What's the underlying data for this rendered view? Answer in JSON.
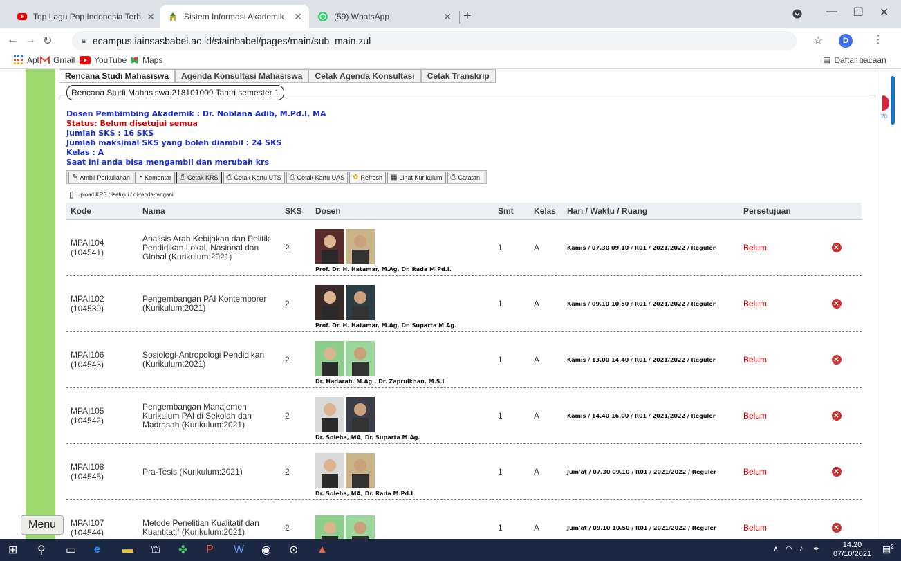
{
  "browser": {
    "tabs": [
      {
        "title": "Top Lagu Pop Indonesia Terbaru",
        "icon": "youtube-icon"
      },
      {
        "title": "Sistem Informasi Akademik",
        "icon": "mosque-icon",
        "active": true
      },
      {
        "title": "(59) WhatsApp",
        "icon": "whatsapp-icon"
      }
    ],
    "url": "ecampus.iainsasbabel.ac.id/stainbabel/pages/main/sub_main.zul",
    "profile_initial": "D",
    "bookmarks": [
      {
        "label": "Apl",
        "icon": "apps-grid-icon"
      },
      {
        "label": "Gmail",
        "icon": "gmail-icon"
      },
      {
        "label": "YouTube",
        "icon": "youtube-icon"
      },
      {
        "label": "Maps",
        "icon": "maps-icon"
      }
    ],
    "reading_list": "Daftar bacaan"
  },
  "subtabs": [
    "Rencana Studi Mahasiswa",
    "Agenda Konsultasi Mahasiswa",
    "Cetak Agenda Konsultasi",
    "Cetak Transkrip"
  ],
  "panel_title": "Rencana Studi Mahasiswa 218101009 Tantri semester 1",
  "info": {
    "dosen": "Dosen Pembimbing Akademik : Dr. Noblana Adib, M.Pd.I, MA",
    "status": "Status: Belum disetujui semua",
    "jumlah_sks": "Jumlah SKS : 16 SKS",
    "max_sks": "Jumlah maksimal SKS yang boleh diambil : 24 SKS",
    "kelas": "Kelas : A",
    "note": "Saat ini anda bisa mengambil dan merubah krs"
  },
  "toolbar_buttons": [
    {
      "label": "Ambil Perkuliahan",
      "icon": "pen-icon"
    },
    {
      "label": "Komentar",
      "icon": "comment-icon"
    },
    {
      "label": "Cetak KRS",
      "icon": "printer-icon"
    },
    {
      "label": "Cetak Kartu UTS",
      "icon": "printer-icon"
    },
    {
      "label": "Cetak Kartu UAS",
      "icon": "printer-icon"
    },
    {
      "label": "Refresh",
      "icon": "refresh-icon"
    },
    {
      "label": "Lihat Kurikulum",
      "icon": "table-icon"
    },
    {
      "label": "Catatan",
      "icon": "printer-icon"
    }
  ],
  "upload_label": "Upload KRS disetujui / di-tanda-tangani",
  "table": {
    "headers": [
      "Kode",
      "Nama",
      "SKS",
      "Dosen",
      "Smt",
      "Kelas",
      "Hari / Waktu / Ruang",
      "Persetujuan",
      ""
    ],
    "rows": [
      {
        "kode": "MPAI104 (104541)",
        "nama": "Analisis Arah Kebijakan dan Politik Pendidikan Lokal, Nasional dan Global (Kurikulum:2021)",
        "sks": "2",
        "dosen": "Prof. Dr. H. Hatamar, M.Ag, Dr. Rada M.Pd.I.",
        "smt": "1",
        "kelas": "A",
        "hari": "Kamis / 07.30 09.10 / R01 / 2021/2022 / Reguler",
        "persetujuan": "Belum"
      },
      {
        "kode": "MPAI102 (104539)",
        "nama": "Pengembangan PAI Kontemporer (Kurikulum:2021)",
        "sks": "2",
        "dosen": "Prof. Dr. H. Hatamar, M.Ag, Dr. Suparta M.Ag.",
        "smt": "1",
        "kelas": "A",
        "hari": "Kamis / 09.10 10.50 / R01 / 2021/2022 / Reguler",
        "persetujuan": "Belum"
      },
      {
        "kode": "MPAI106 (104543)",
        "nama": "Sosiologi-Antropologi Pendidikan (Kurikulum:2021)",
        "sks": "2",
        "dosen": "Dr. Hadarah, M.Ag., Dr. Zaprulkhan, M.S.I",
        "smt": "1",
        "kelas": "A",
        "hari": "Kamis / 13.00 14.40 / R01 / 2021/2022 / Reguler",
        "persetujuan": "Belum"
      },
      {
        "kode": "MPAI105 (104542)",
        "nama": "Pengembangan Manajemen Kurikulum PAI di Sekolah dan Madrasah (Kurikulum:2021)",
        "sks": "2",
        "dosen": "Dr. Soleha, MA, Dr. Suparta M.Ag.",
        "smt": "1",
        "kelas": "A",
        "hari": "Kamis / 14.40 16.00 / R01 / 2021/2022 / Reguler",
        "persetujuan": "Belum"
      },
      {
        "kode": "MPAI108 (104545)",
        "nama": "Pra-Tesis (Kurikulum:2021)",
        "sks": "2",
        "dosen": "Dr. Soleha, MA, Dr. Rada M.Pd.I.",
        "smt": "1",
        "kelas": "A",
        "hari": "Jum'at / 07.30 09.10 / R01 / 2021/2022 / Reguler",
        "persetujuan": "Belum"
      },
      {
        "kode": "MPAI107 (104544)",
        "nama": "Metode Penelitian Kualitatif dan Kuantitatif (Kurikulum:2021)",
        "sks": "2",
        "dosen": "",
        "smt": "1",
        "kelas": "A",
        "hari": "Jum'at / 09.10 10.50 / R01 / 2021/2022 / Reguler",
        "persetujuan": "Belum"
      }
    ]
  },
  "menu_label": "Menu",
  "right_rail_number": "20",
  "taskbar": {
    "time": "14.20",
    "date": "07/10/2021",
    "notifications": "2"
  },
  "colors": {
    "accent_green": "#9dd86f",
    "label_blue": "#1d2fcf",
    "status_red": "#d40000",
    "taskbar": "#1c2841"
  }
}
